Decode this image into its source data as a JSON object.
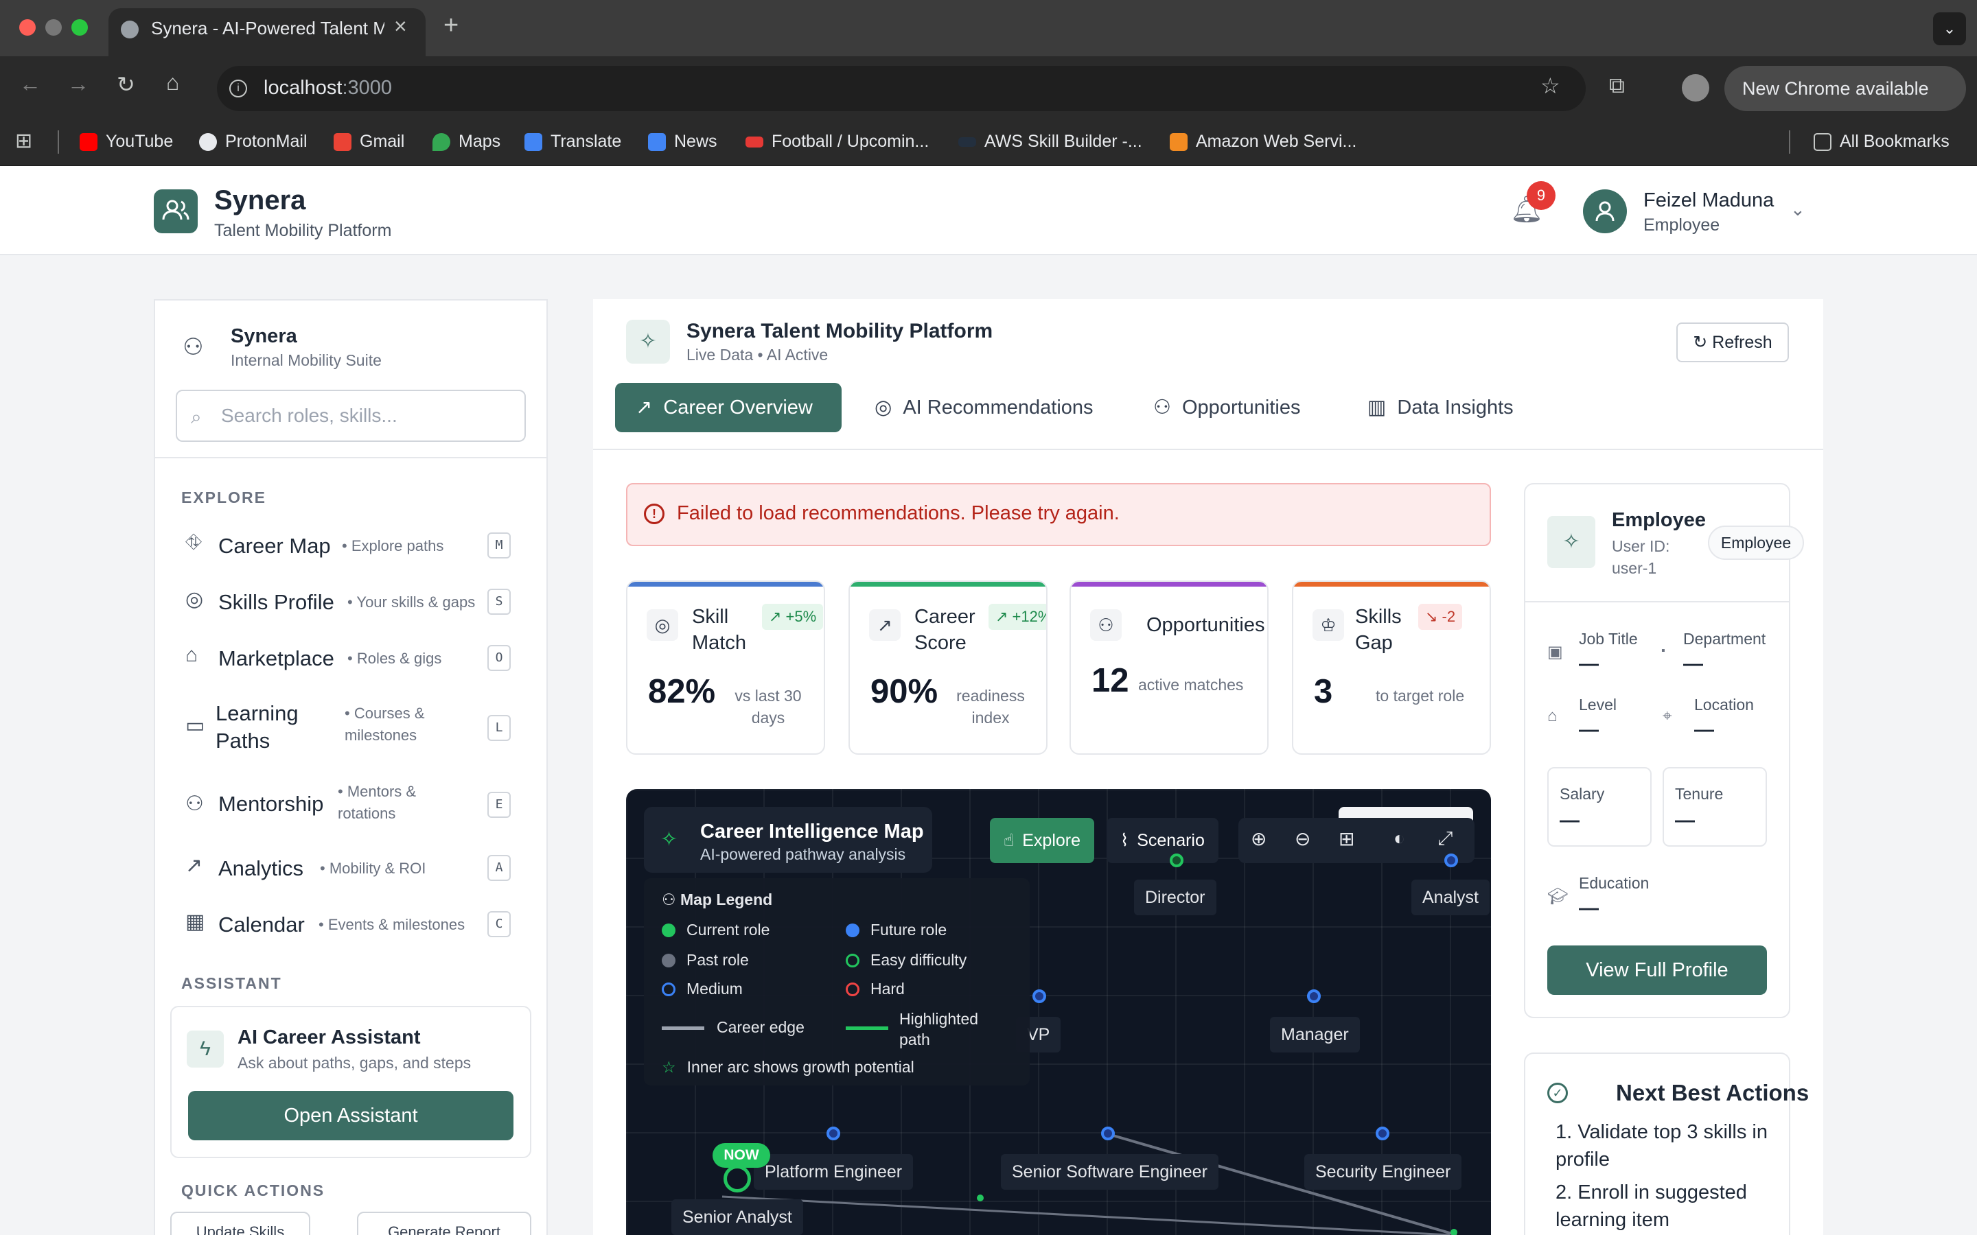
{
  "browser": {
    "tab_title": "Synera - AI-Powered Talent M",
    "url_host": "localhost",
    "url_port": ":3000",
    "new_chrome": "New Chrome available",
    "bookmarks": [
      "YouTube",
      "ProtonMail",
      "Gmail",
      "Maps",
      "Translate",
      "News",
      "Football / Upcomin...",
      "AWS Skill Builder -...",
      "Amazon Web Servi...",
      "All Bookmarks"
    ]
  },
  "header": {
    "brand": "Synera",
    "brand_sub": "Talent Mobility Platform",
    "notifications": "9",
    "user_name": "Feizel Maduna",
    "user_role": "Employee"
  },
  "sidebar": {
    "title": "Synera",
    "subtitle": "Internal Mobility Suite",
    "search_placeholder": "Search roles, skills...",
    "explore_label": "EXPLORE",
    "items": [
      {
        "label": "Career Map",
        "desc": "• Explore paths",
        "key": "M"
      },
      {
        "label": "Skills Profile",
        "desc": "• Your skills & gaps",
        "key": "S"
      },
      {
        "label": "Marketplace",
        "desc": "• Roles & gigs",
        "key": "O"
      },
      {
        "label": "Learning Paths",
        "desc": "• Courses & milestones",
        "key": "L"
      },
      {
        "label": "Mentorship",
        "desc": "• Mentors & rotations",
        "key": "E"
      },
      {
        "label": "Analytics",
        "desc": "• Mobility & ROI",
        "key": "A"
      },
      {
        "label": "Calendar",
        "desc": "• Events & milestones",
        "key": "C"
      }
    ],
    "assistant_label": "ASSISTANT",
    "assistant_title": "AI Career Assistant",
    "assistant_sub": "Ask about paths, gaps, and steps",
    "assistant_button": "Open Assistant",
    "quick_actions_label": "QUICK ACTIONS",
    "quick_actions": [
      "Update Skills",
      "Generate Report"
    ]
  },
  "main": {
    "title": "Synera Talent Mobility Platform",
    "subtitle": "Live Data • AI Active",
    "refresh": "Refresh",
    "tabs": [
      "Career Overview",
      "AI Recommendations",
      "Opportunities",
      "Data Insights"
    ],
    "alert": "Failed to load recommendations. Please try again.",
    "kpis": [
      {
        "label": "Skill Match",
        "trend": "↗ +5%",
        "value": "82%",
        "note": "vs last 30 days",
        "color": "#4a7bd0"
      },
      {
        "label": "Career Score",
        "trend": "↗ +12%",
        "value": "90%",
        "note": "readiness index",
        "color": "#2eae6e"
      },
      {
        "label": "Opportunities",
        "trend": "",
        "value": "12",
        "note": "active matches",
        "color": "#9b4dd0"
      },
      {
        "label": "Skills Gap",
        "trend": "↘ -2",
        "value": "3",
        "note": "to target role",
        "color": "#e8692b"
      }
    ]
  },
  "map": {
    "title": "Career Intelligence Map",
    "subtitle": "AI-powered pathway analysis",
    "explore": "Explore",
    "scenario": "Scenario",
    "legend_title": "Map Legend",
    "legend": {
      "current": "Current role",
      "future": "Future role",
      "past": "Past role",
      "easy": "Easy difficulty",
      "medium": "Medium",
      "hard": "Hard",
      "edge": "Career edge",
      "highlighted": "Highlighted path",
      "arc": "Inner arc shows growth potential"
    },
    "nodes": [
      "Director",
      "Analyst",
      "VP",
      "Manager",
      "Platform Engineer",
      "Senior Software Engineer",
      "Security Engineer",
      "Senior Analyst"
    ],
    "now_badge": "NOW"
  },
  "profile": {
    "name": "Employee",
    "user_id": "User ID: user-1",
    "pill": "Employee",
    "fields": [
      {
        "label": "Job Title",
        "value": "—"
      },
      {
        "label": "Department",
        "value": "—"
      },
      {
        "label": "Level",
        "value": "—"
      },
      {
        "label": "Location",
        "value": "—"
      },
      {
        "label": "Salary",
        "value": "—"
      },
      {
        "label": "Tenure",
        "value": "—"
      },
      {
        "label": "Education",
        "value": "—"
      }
    ],
    "button": "View Full Profile"
  },
  "next_actions": {
    "title": "Next Best Actions",
    "items": [
      "1. Validate top 3 skills in profile",
      "2. Enroll in suggested learning item"
    ]
  }
}
